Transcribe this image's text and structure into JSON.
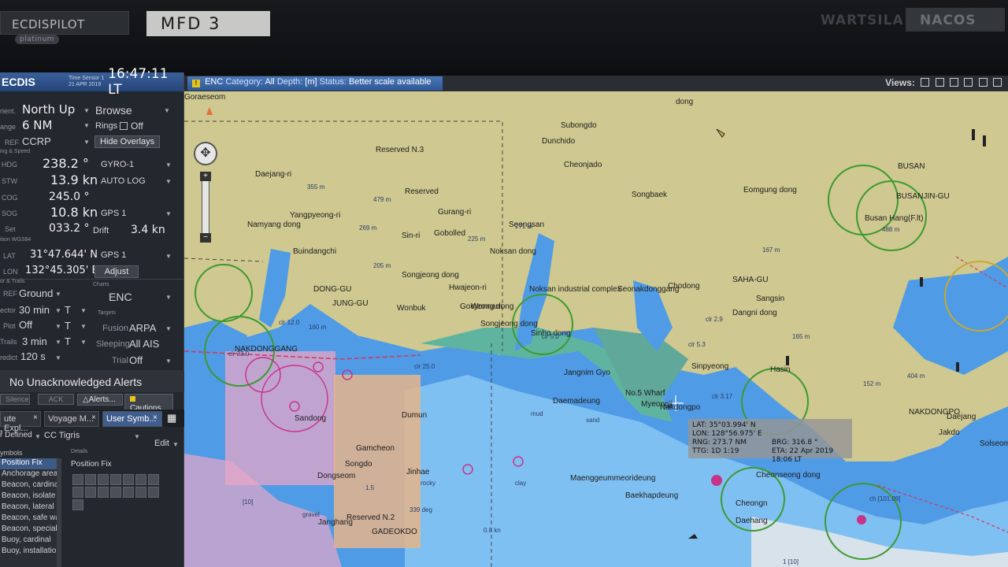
{
  "bezel": {
    "ecdispilot": "ECDISPILOT",
    "ecdispilot_badge": "platinum",
    "mfd": "MFD 3",
    "brand": "WARTSILA",
    "nacos": "NACOS"
  },
  "header": {
    "app": "ECDIS",
    "sensor": "Time Sensor 1",
    "date": "21 APR 2019",
    "time": "16:47:11 LT"
  },
  "display": {
    "orient_label": "rient.",
    "orient": "North Up",
    "mode": "Browse",
    "range_label": "ange",
    "range": "6 NM",
    "rings_label": "Rings",
    "rings": "Off",
    "ref_label": "REF",
    "ref": "CCRP",
    "hide_overlays": "Hide Overlays",
    "heading_speed_label": "ing & Speed"
  },
  "nav": {
    "hdg_label": "HDG",
    "hdg": "238.2 °",
    "hdg_src": "GYRO-1",
    "stw_label": "STW",
    "stw": "13.9 kn",
    "stw_src": "AUTO LOG",
    "cog_label": "COG",
    "cog": "245.0 °",
    "sog_label": "SOG",
    "sog": "10.8 kn",
    "sog_src": "GPS 1",
    "set_label": "Set",
    "set": "033.2 °",
    "drift_label": "Drift",
    "drift": "3.4 kn",
    "position_label": "ition WGS84",
    "lat_label": "LAT",
    "lat": "31°47.644' N",
    "lat_src": "GPS 1",
    "lon_label": "LON",
    "lon": "132°45.305' E",
    "adjust": "Adjust"
  },
  "vectors": {
    "section_label": "or & Trails",
    "ref_label": "REF",
    "ref": "Ground",
    "vector_label": "ector",
    "vector": "30 min",
    "vector_t": "T",
    "plot_label": "Plot",
    "plot": "Off",
    "plot_t": "T",
    "trails_label": "Trails",
    "trails": "3 min",
    "trails_t": "T",
    "predict_label": "redict",
    "predict": "120 s"
  },
  "charts": {
    "label": "Charts",
    "value": "ENC",
    "targets_label": "Targets",
    "fusion_label": "Fusion",
    "fusion": "ARPA",
    "sleeping_label": "Sleeping",
    "sleeping": "All AIS",
    "trial_label": "Trial",
    "trial": "Off"
  },
  "alerts": {
    "text": "No Unacknowledged Alerts",
    "silence": "Silence",
    "ack": "ACK",
    "alerts_btn": "Alerts...",
    "cautions_btn": "Cautions..."
  },
  "tabs": [
    "ute Expl...",
    "Voyage M...",
    "User Symb..."
  ],
  "symbols": {
    "filter": "r Defined",
    "set": "CC Tigris",
    "edit": "Edit",
    "header": "ymbols",
    "details": "Details",
    "detail_title": "Position Fix",
    "items": [
      "Position Fix",
      "Anchorage area",
      "Beacon, cardina",
      "Beacon, isolate",
      "Beacon, lateral",
      "Beacon, safe wa",
      "Beacon, special",
      "Buoy, cardinal",
      "Buoy, installatio"
    ]
  },
  "enc_bar": {
    "enc": "ENC",
    "category_label": "Category:",
    "category": "All",
    "depth_label": "Depth:",
    "depth": "[m]",
    "status_label": "Status:",
    "status": "Better scale available",
    "views": "Views:"
  },
  "readout": {
    "lat_label": "LAT:",
    "lat": "35°03.994' N",
    "lon_label": "LON:",
    "lon": "128°56.975' E",
    "rng_label": "RNG:",
    "rng": "273.7 NM",
    "ttg_label": "TTG:",
    "ttg": "1D 1:19",
    "brg_label": "BRG:",
    "brg": "316.8 °",
    "eta_label": "ETA:",
    "eta": "22 Apr 2019 18:06 LT"
  },
  "places": [
    "dong",
    "Subongdo",
    "Dunchido",
    "Cheonjado",
    "Songbaek",
    "Eomgung dong",
    "BUSAN",
    "BUSANJIN-GU",
    "Busan Hang(F.lt)",
    "Daejang-ri",
    "Yangpyeong-ri",
    "Gurang-ri",
    "Seongsan",
    "Namyang dong",
    "Sin-ri",
    "Buindangchi",
    "Noksan dong",
    "Songjeong dong",
    "Hwajeon-ri",
    "Noksan industrial complex",
    "Seonakdonggang",
    "Chodong",
    "Sangsin",
    "SAHA-GU",
    "Dangni dong",
    "Goejeong dong",
    "DONG-GU",
    "JUNG-GU",
    "Wonbuk",
    "Wonnam",
    "Songjeong dong",
    "Sinho dong",
    "Sinpyeong",
    "Hasin",
    "Jangnim Gyo",
    "No.5 Wharf",
    "Daemadeung",
    "Maenggeummeorideung",
    "Baekhapdeung",
    "Myeongji",
    "Nakdongpo",
    "NAKDONGPO",
    "NAKDONGGANG",
    "Sandong",
    "Gamcheon",
    "Songdo",
    "Jinhae",
    "Janghang",
    "GADEOKDO",
    "Dumun",
    "Cheonseong dong",
    "Cheongn",
    "Daehang",
    "Daejang",
    "Jakdo",
    "Solseom",
    "Goraeseom",
    "Dongseom",
    "Reserved N.2",
    "Reserved N.3",
    "Reserved",
    "Gobolled"
  ],
  "depths": [
    "355 m",
    "479 m",
    "269 m",
    "225 m",
    "271 m",
    "205 m",
    "160 m",
    "167 m",
    "488 m",
    "404 m",
    "152 m",
    "165 m",
    "clr 12.0",
    "clr 5.0",
    "clr 2.9",
    "clr 5.3",
    "clr 3.17",
    "clr 25.0",
    "clr 33.0",
    "mud",
    "sand",
    "clay",
    "rocky",
    "gravel",
    "0.8 kn",
    "ch [101.09]",
    "1 [10]",
    "[10]",
    "1.5",
    "339 deg"
  ]
}
